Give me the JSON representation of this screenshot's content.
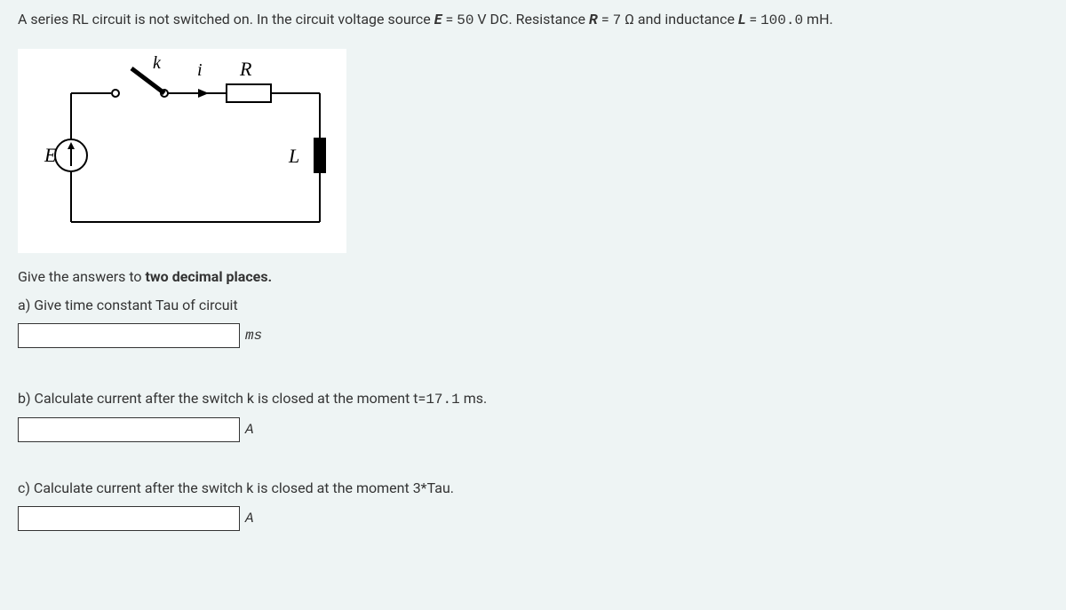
{
  "problem": {
    "intro_part1": "A series RL circuit is not switched on. In the circuit voltage source ",
    "E_label": "E",
    "E_equals": " = ",
    "E_value": "50",
    "E_unit": " V DC. Resistance ",
    "R_label": "R",
    "R_equals": " = ",
    "R_value": "7",
    "R_unit": " Ω and inductance ",
    "L_label": "L",
    "L_equals": " = ",
    "L_value": "100.0",
    "L_unit": " mH."
  },
  "circuit_labels": {
    "E": "E",
    "k": "k",
    "i": "i",
    "R": "R",
    "L": "L"
  },
  "instructions": {
    "precision_part1": "Give the answers to ",
    "precision_bold": "two decimal places."
  },
  "questions": {
    "a": {
      "text": "a) Give time constant Tau of circuit",
      "unit": "ms"
    },
    "b": {
      "text_part1": "b) Calculate current after the switch k is closed at the moment t=",
      "t_value": "17.1",
      "text_part2": " ms.",
      "unit": "A"
    },
    "c": {
      "text": "c) Calculate current after the switch k is closed at the moment 3*Tau.",
      "unit": "A"
    }
  }
}
